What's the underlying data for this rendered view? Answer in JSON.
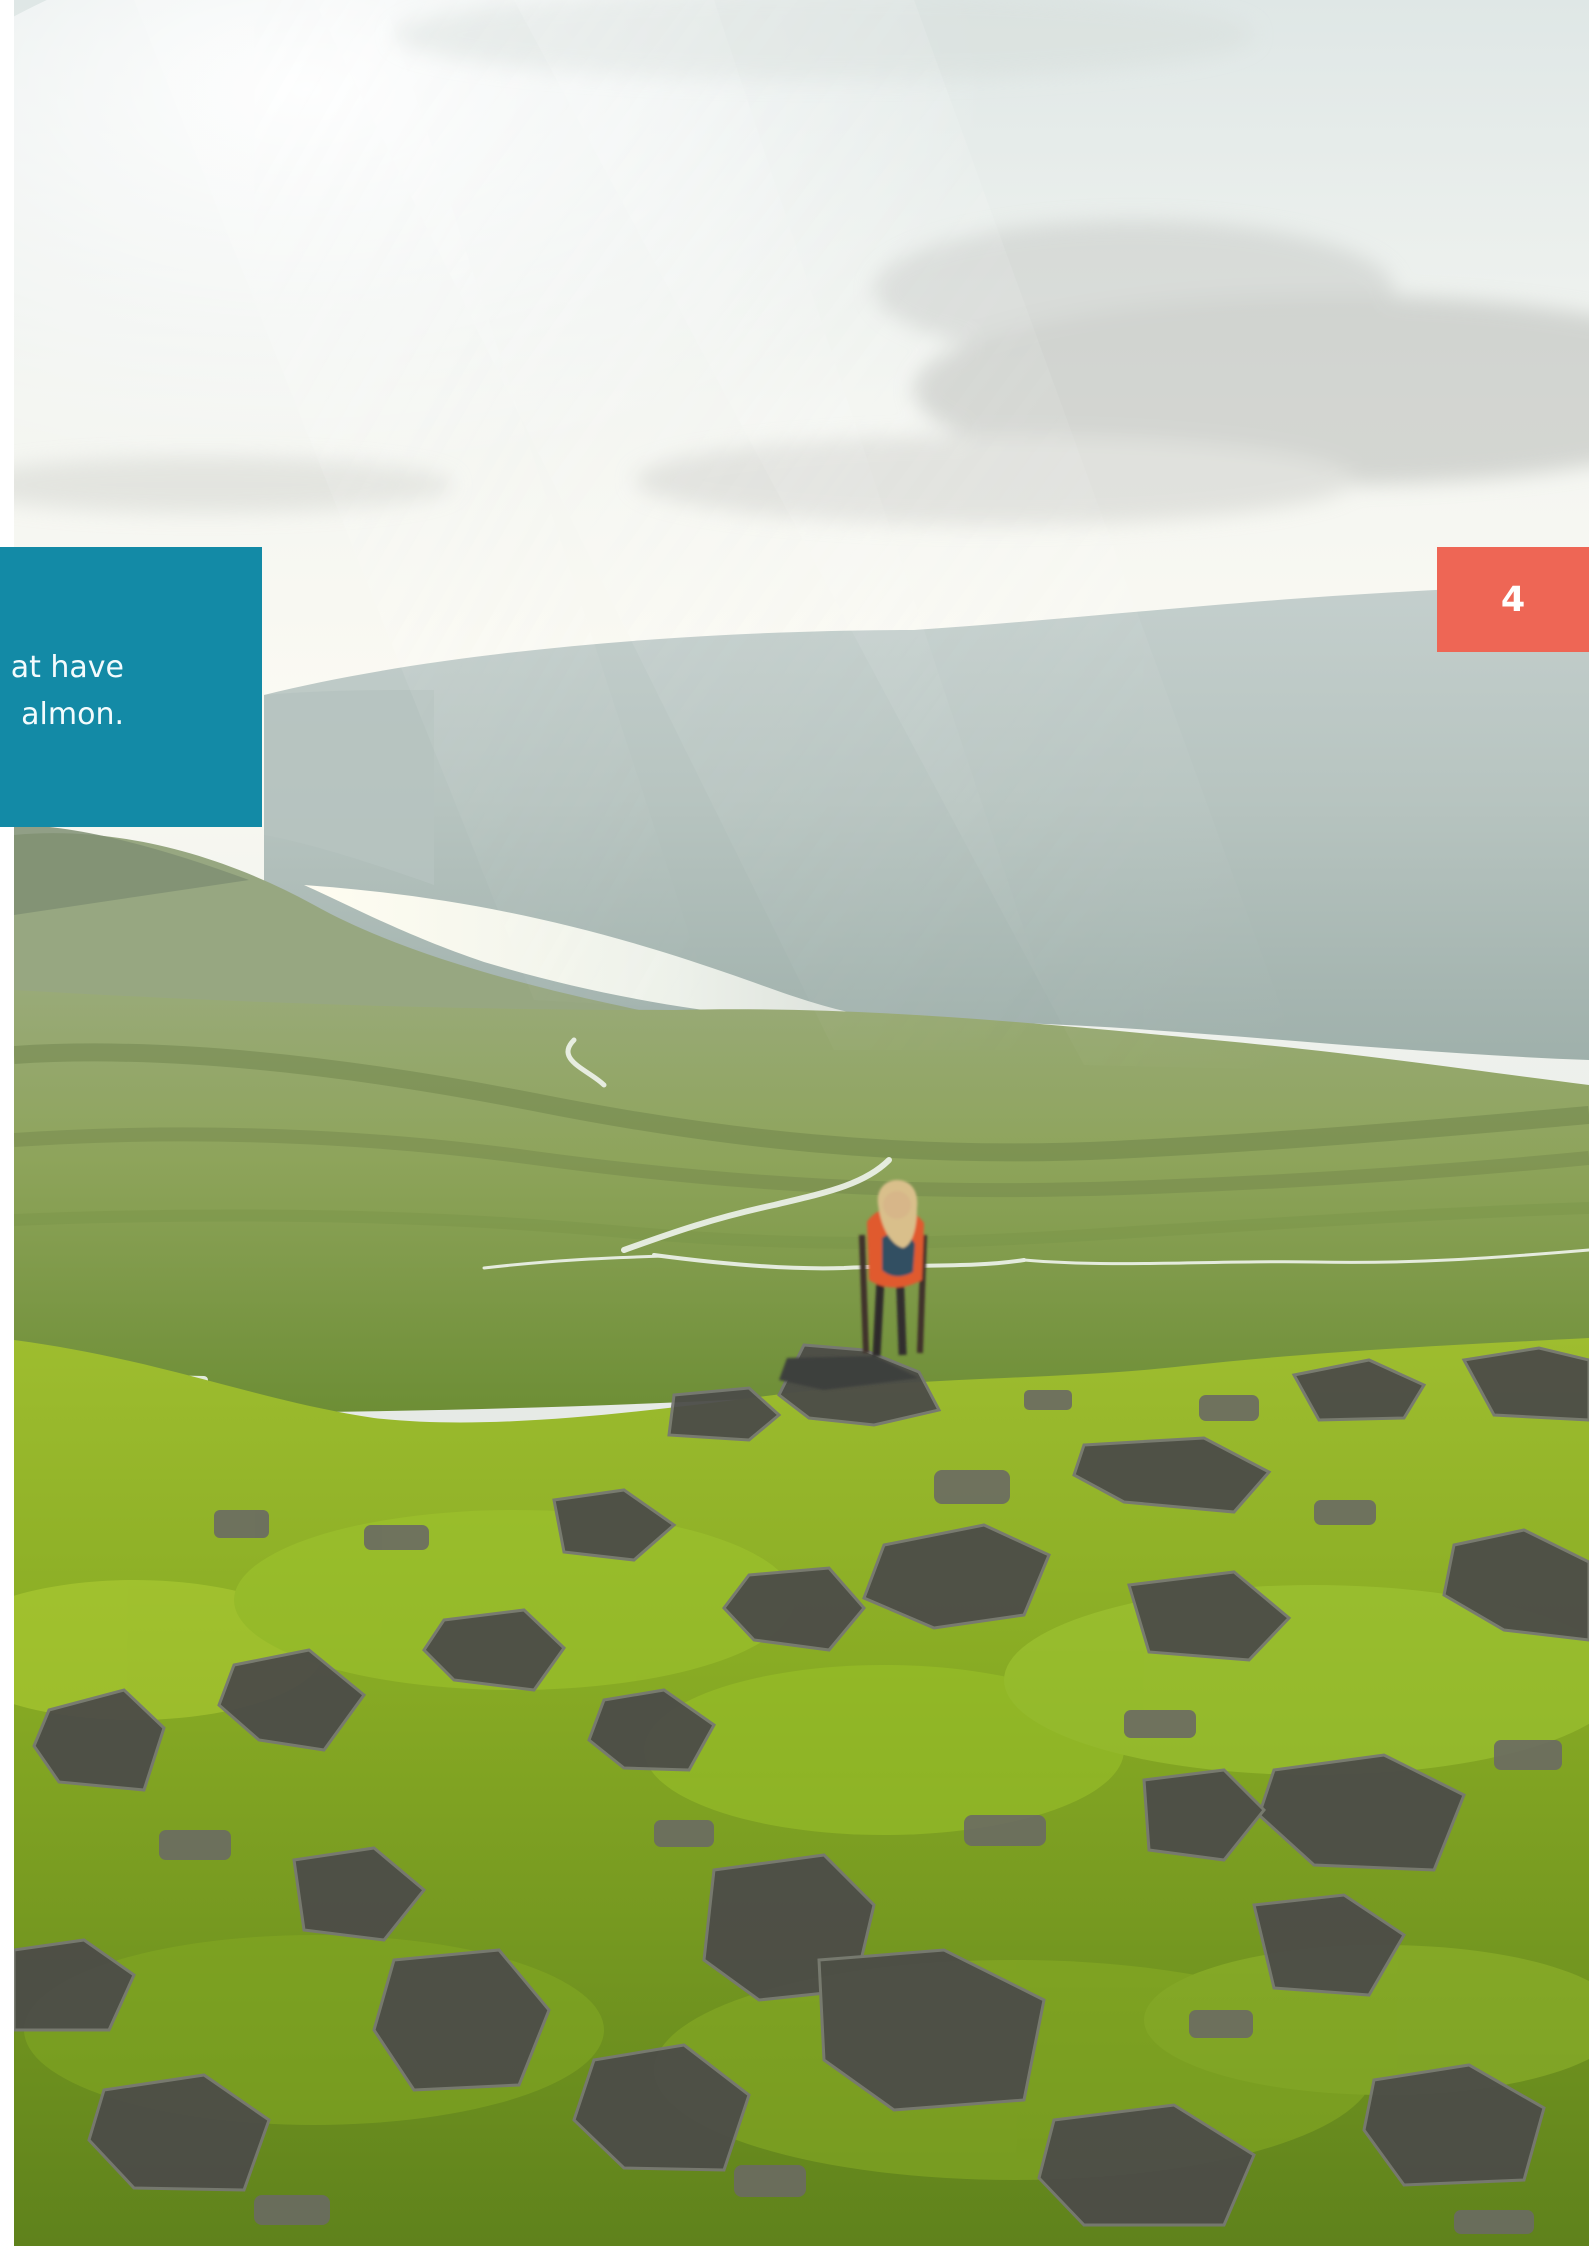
{
  "document": {
    "page_number": "4",
    "caption": {
      "line_1": "at have",
      "line_2": "almon."
    },
    "photo": {
      "subject_icon": "hiker-landscape-photo"
    },
    "colors": {
      "caption_box": "#138aa6",
      "page_number_box": "#ee6655",
      "caption_text": "#f3fbfd",
      "page_background": "#ffffff"
    }
  }
}
